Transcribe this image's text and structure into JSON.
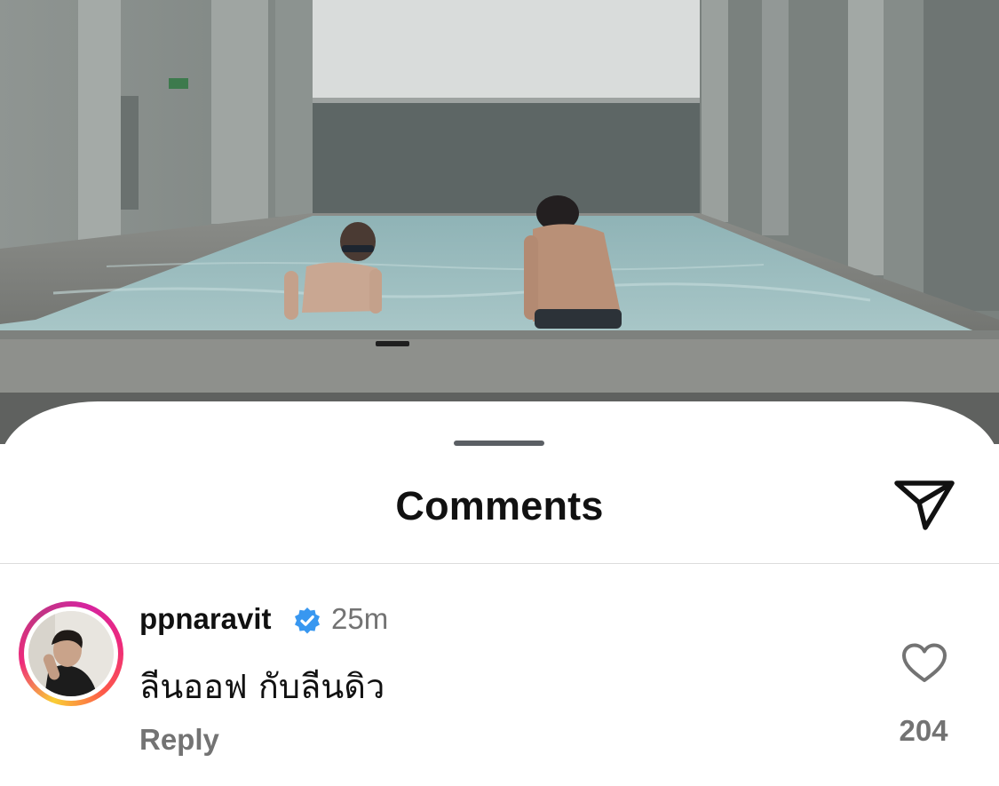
{
  "post": {
    "photo_icon": "pool-photo"
  },
  "sheet": {
    "title": "Comments",
    "share_icon": "paper-plane-icon"
  },
  "comments": [
    {
      "username": "ppnaravit",
      "verified": true,
      "time": "25m",
      "text": "ลีนออฟ กับลีนดิว",
      "reply_label": "Reply",
      "like_icon": "heart-icon",
      "likes": "204"
    }
  ],
  "colors": {
    "text_primary": "#111111",
    "text_secondary": "#737373",
    "verified_blue": "#3897f0",
    "pool_water": "#a7c7c9"
  }
}
